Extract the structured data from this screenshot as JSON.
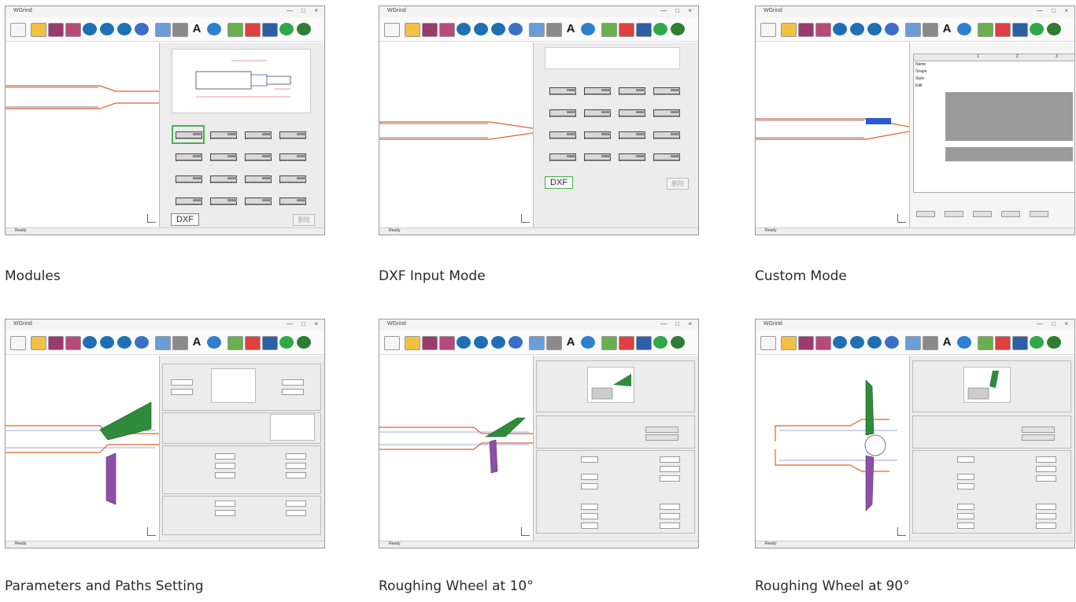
{
  "captions": [
    "Modules",
    "DXF Input Mode",
    "Custom Mode",
    "Parameters and Paths Setting",
    "Roughing Wheel at 10°",
    "Roughing Wheel at 90°"
  ],
  "app": {
    "window_title": "WGrind",
    "minimize_glyph": "—",
    "maximize_glyph": "□",
    "close_glyph": "×",
    "status_text": "Ready",
    "toolbar_letter": "A"
  },
  "toolbar_icons": [
    {
      "name": "new-file-icon",
      "color": "#f5f5f5"
    },
    {
      "name": "open-folder-icon",
      "color": "#f2c043"
    },
    {
      "name": "save-icon",
      "color": "#9b3a6d"
    },
    {
      "name": "save-as-icon",
      "color": "#b84a7a"
    },
    {
      "name": "zoom-in-icon",
      "color": "#1f6fb4"
    },
    {
      "name": "zoom-out-icon",
      "color": "#1f6fb4"
    },
    {
      "name": "zoom-fit-icon",
      "color": "#1f6fb4"
    },
    {
      "name": "pan-icon",
      "color": "#3b6fc7"
    },
    {
      "name": "measure-icon",
      "color": "#6b9ed6"
    },
    {
      "name": "pencil-icon",
      "color": "#8a8a8a"
    },
    {
      "name": "text-icon",
      "color": "#1a1a1a"
    },
    {
      "name": "help-icon",
      "color": "#2f7fd0"
    },
    {
      "name": "grid-icon",
      "color": "#6ab04c"
    },
    {
      "name": "origin-icon",
      "color": "#e04040"
    },
    {
      "name": "copy-icon",
      "color": "#2d5fa8"
    },
    {
      "name": "up-arrow-icon",
      "color": "#2fa84a"
    },
    {
      "name": "refresh-icon",
      "color": "#2e7d32"
    }
  ],
  "panels": {
    "dxf_button": "DXF",
    "delete_button": "删除",
    "custom_headers": [
      "1",
      "2",
      "3"
    ],
    "custom_rows": [
      "Name",
      "Shape",
      "Style",
      "Edit"
    ]
  },
  "colors": {
    "wheel_green": "#2e8b3a",
    "wheel_purple": "#8e4fa8",
    "profile_orange": "#e06030",
    "path_blue": "#7f8fd8",
    "highlight_blue": "#2a5ad0"
  }
}
